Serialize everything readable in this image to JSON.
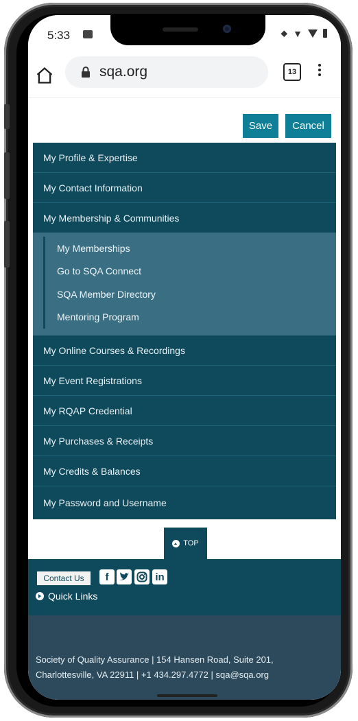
{
  "status": {
    "time": "5:33",
    "icons": [
      "image-icon",
      "location-icon",
      "wifi-icon",
      "signal-icon",
      "battery-icon"
    ]
  },
  "browser": {
    "url": "sqa.org",
    "tab_count": "13"
  },
  "actions": {
    "save_label": "Save",
    "cancel_label": "Cancel"
  },
  "menu": {
    "items": [
      "My Profile & Expertise",
      "My Contact Information",
      "My Membership & Communities"
    ],
    "submenu": [
      "My Memberships",
      "Go to SQA Connect",
      "SQA Member Directory",
      "Mentoring Program"
    ],
    "items_after": [
      "My Online Courses & Recordings",
      "My Event Registrations",
      "My RQAP Credential",
      "My Purchases & Receipts",
      "My Credits & Balances",
      "My Password and Username"
    ]
  },
  "footer": {
    "top_label": "TOP",
    "contact_label": "Contact Us",
    "quick_links": "Quick Links",
    "address_line1": "Society of Quality Assurance | 154 Hansen Road, Suite 201,",
    "address_line2": "Charlottesville, VA 22911 | +1 434.297.4772 | sqa@sqa.org"
  },
  "colors": {
    "accent": "#0f7f97",
    "menu_bg": "#0e4a5c",
    "submenu_bg": "#3a6e82",
    "footer_bottom": "#2c4a5c"
  }
}
